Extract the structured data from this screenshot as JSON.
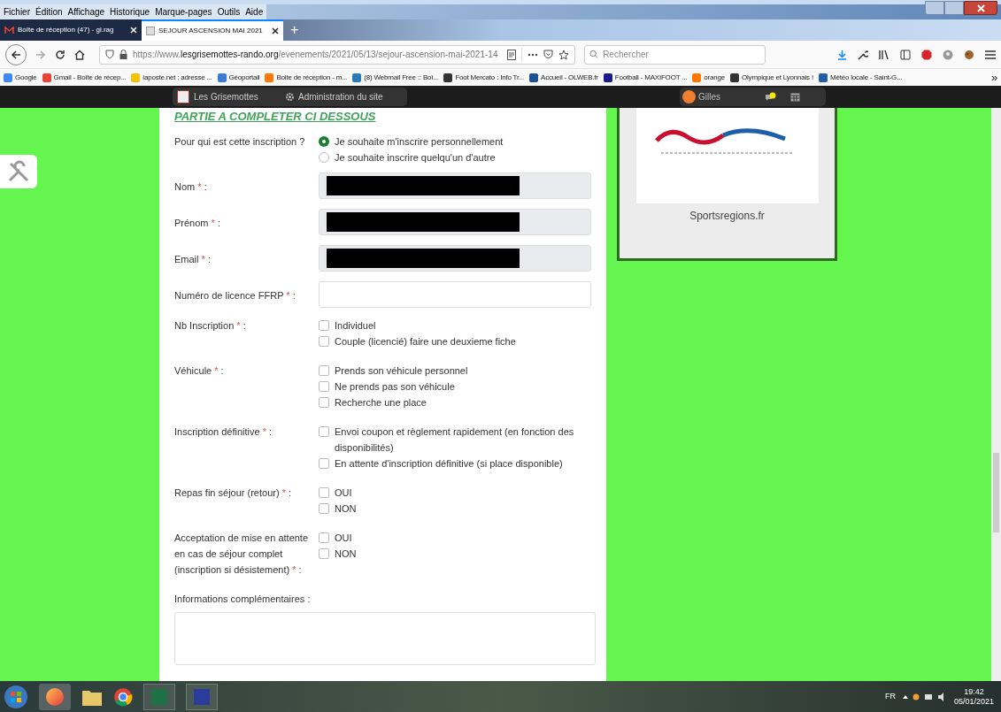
{
  "browser": {
    "menu": [
      "Fichier",
      "Édition",
      "Affichage",
      "Historique",
      "Marque-pages",
      "Outils",
      "Aide"
    ],
    "tabs": [
      {
        "title": "Boîte de réception (47) - gi.rag",
        "selected": false
      },
      {
        "title": "SEJOUR ASCENSION MAI 2021",
        "selected": true
      }
    ],
    "url": {
      "prefix": "https://www.",
      "domain": "lesgrisemottes-rando.org",
      "path": "/evenements/2021/05/13/sejour-ascension-mai-2021-14"
    },
    "new_tab": "+",
    "search_placeholder": "Rechercher",
    "bookmarks": [
      "Google",
      "Gmail - Boîte de récep...",
      "laposte.net : adresse ...",
      "Géoportail",
      "Boite de réception - m...",
      "(8) Webmail Free :: Boî...",
      "Foot Mercato : Info Tr...",
      "Accueil - OLWEB.fr",
      "Football - MAXIFOOT ...",
      "orange",
      "Olympique et Lyonnais !",
      "Météo locale - Saint-G..."
    ],
    "bookmarks_overflow": "»"
  },
  "site_bar": {
    "site_name": "Les Grisemottes",
    "admin_label": "Administration du site",
    "user_name": "Gilles"
  },
  "form": {
    "heading": "PARTIE A COMPLETER CI DESSOUS",
    "fields": [
      {
        "kind": "radio",
        "label": "Pour qui est cette inscription ?",
        "options": [
          {
            "label": "Je souhaite m'inscrire personnellement",
            "selected": true
          },
          {
            "label": "Je souhaite inscrire quelqu'un d'autre",
            "selected": false
          }
        ]
      },
      {
        "kind": "text",
        "label": "Nom",
        "mark": "*",
        "suffix": ":",
        "disabled": true,
        "redacted": true
      },
      {
        "kind": "text",
        "label": "Prénom",
        "mark": "*",
        "suffix": ":",
        "disabled": true,
        "redacted": true
      },
      {
        "kind": "text",
        "label": "Email",
        "mark": "*",
        "suffix": ":",
        "disabled": true,
        "redacted": true
      },
      {
        "kind": "text",
        "label": "Numéro de licence FFRP",
        "mark": "*",
        "suffix": ":",
        "disabled": false,
        "redacted": false
      },
      {
        "kind": "checkbox",
        "label": "Nb Inscription",
        "mark": "*",
        "suffix": ":",
        "options": [
          {
            "label": "Individuel",
            "checked": false
          },
          {
            "label": "Couple (licencié) faire une deuxieme fiche",
            "checked": false
          }
        ]
      },
      {
        "kind": "checkbox",
        "label": "Véhicule",
        "mark": "*",
        "suffix": ":",
        "options": [
          {
            "label": "Prends son véhicule personnel",
            "checked": false
          },
          {
            "label": "Ne prends pas son véhicule",
            "checked": false
          },
          {
            "label": "Recherche une place",
            "checked": false
          }
        ]
      },
      {
        "kind": "checkbox",
        "label": "Inscription définitive",
        "mark": "*",
        "suffix": ":",
        "options": [
          {
            "label": "Envoi coupon et règlement rapidement (en fonction des disponibilités)",
            "checked": false
          },
          {
            "label": "En attente d'inscription définitive (si place disponible)",
            "checked": false
          }
        ]
      },
      {
        "kind": "checkbox",
        "label": "Repas fin séjour (retour)",
        "mark": "*",
        "suffix": ":",
        "options": [
          {
            "label": "OUI",
            "checked": false
          },
          {
            "label": "NON",
            "checked": false
          }
        ]
      },
      {
        "kind": "checkbox",
        "label": "Acceptation de mise en attente en cas de séjour complet (inscription si désistement)",
        "mark": "*",
        "suffix": ":",
        "options": [
          {
            "label": "OUI",
            "checked": false
          },
          {
            "label": "NON",
            "checked": false
          }
        ]
      },
      {
        "kind": "textarea",
        "label": "Informations complémentaires :"
      }
    ]
  },
  "partner_card": {
    "caption": "Sportsregions.fr"
  },
  "taskbar": {
    "language": "FR",
    "time": "19:42",
    "date": "05/01/2021"
  }
}
